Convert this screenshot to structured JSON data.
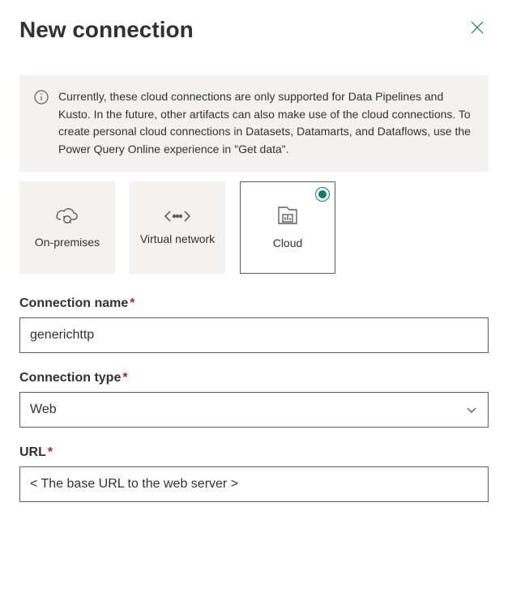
{
  "header": {
    "title": "New connection"
  },
  "info": {
    "text": "Currently, these cloud connections are only supported for Data Pipelines and Kusto. In the future, other artifacts can also make use of the cloud connections. To create personal cloud connections in Datasets, Datamarts, and Dataflows, use the Power Query Online experience in \"Get data\"."
  },
  "tabs": {
    "onprem": {
      "label": "On-premises"
    },
    "vnet": {
      "label": "Virtual network"
    },
    "cloud": {
      "label": "Cloud"
    }
  },
  "form": {
    "connection_name": {
      "label": "Connection name",
      "value": "generichttp"
    },
    "connection_type": {
      "label": "Connection type",
      "value": "Web"
    },
    "url": {
      "label": "URL",
      "value": "< The base URL to the web server >"
    }
  },
  "required_marker": "*"
}
